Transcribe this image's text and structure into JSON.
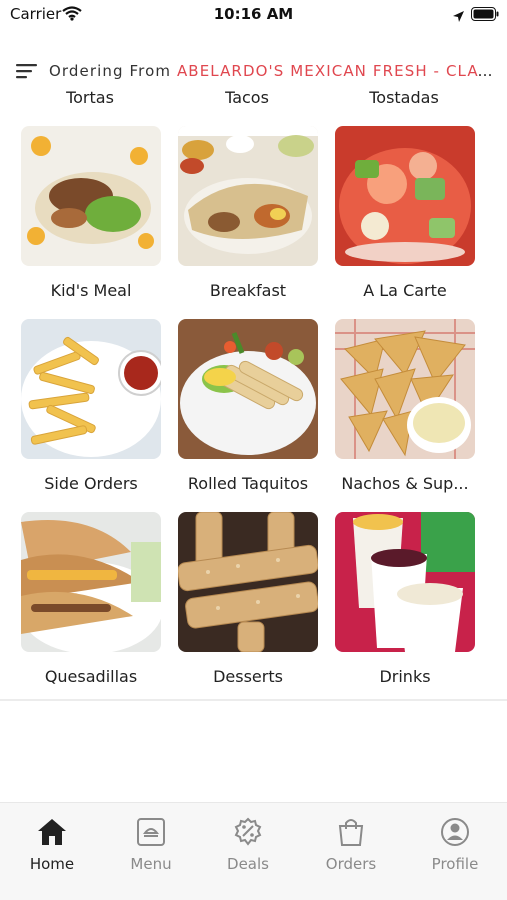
{
  "status_bar": {
    "carrier": "Carrier",
    "time": "10:16 AM"
  },
  "header": {
    "ordering_prefix": "Ordering From",
    "restaurant_name": "ABELARDO'S MEXICAN FRESH - CLAY..."
  },
  "partial_row": [
    "Tortas",
    "Tacos",
    "Tostadas"
  ],
  "categories": [
    {
      "label": "Kid's Meal"
    },
    {
      "label": "Breakfast"
    },
    {
      "label": "A La Carte"
    },
    {
      "label": "Side Orders"
    },
    {
      "label": "Rolled Taquitos"
    },
    {
      "label": "Nachos & Sup..."
    },
    {
      "label": "Quesadillas"
    },
    {
      "label": "Desserts"
    },
    {
      "label": "Drinks"
    }
  ],
  "tabs": [
    {
      "label": "Home",
      "icon": "home-icon",
      "active": true
    },
    {
      "label": "Menu",
      "icon": "menu-tray-icon",
      "active": false
    },
    {
      "label": "Deals",
      "icon": "deals-percent-icon",
      "active": false
    },
    {
      "label": "Orders",
      "icon": "shopping-bag-icon",
      "active": false
    },
    {
      "label": "Profile",
      "icon": "profile-icon",
      "active": false
    }
  ],
  "colors": {
    "accent": "#e0474f",
    "tab_active": "#222222",
    "tab_inactive": "#8a8a8a"
  }
}
